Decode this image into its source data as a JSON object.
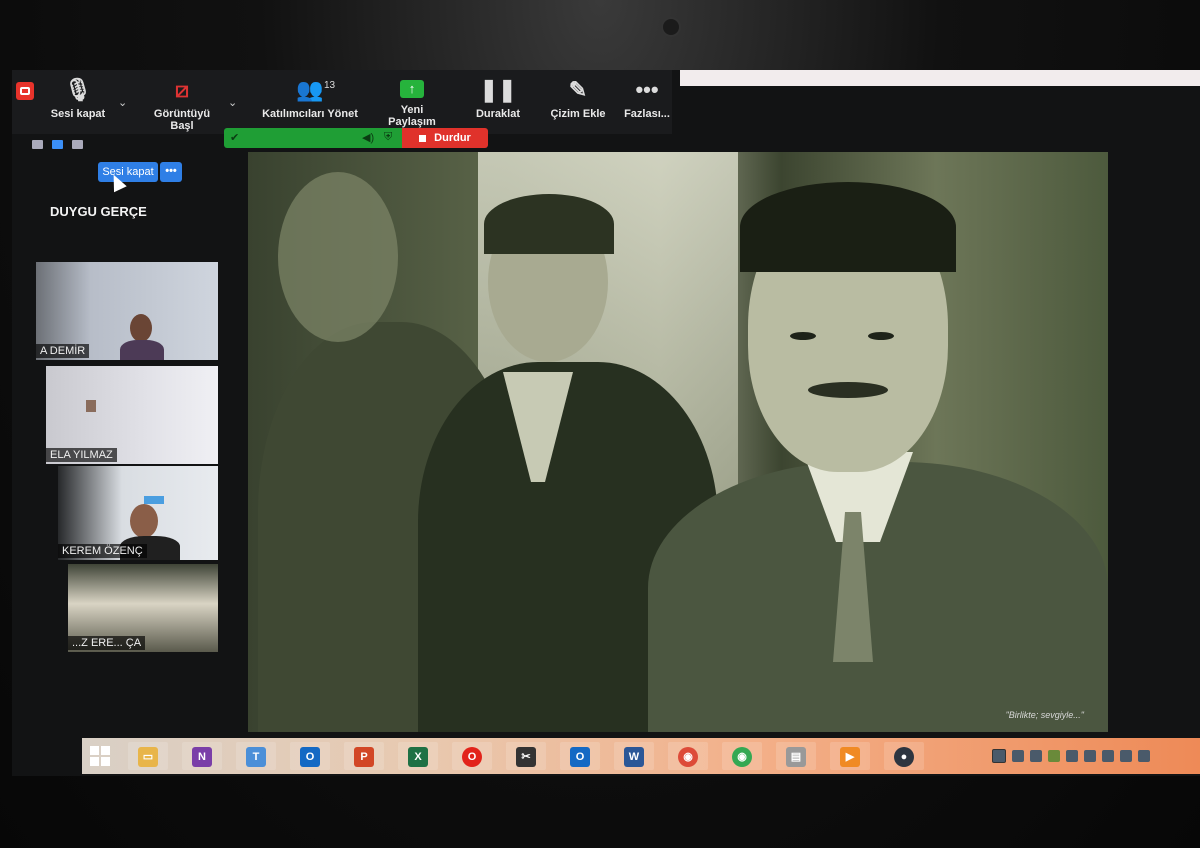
{
  "toolbar": {
    "mute": {
      "label": "Sesi kapat",
      "icon": "microphone-icon"
    },
    "video": {
      "label": "Görüntüyü Başl",
      "icon": "video-off-icon"
    },
    "participants": {
      "label": "Katılımcıları Yönet",
      "count": "13",
      "icon": "participants-icon"
    },
    "share": {
      "label": "Yeni Paylaşım",
      "icon": "share-arrow-icon"
    },
    "pause": {
      "label": "Duraklat",
      "icon": "pause-icon"
    },
    "annotate": {
      "label": "Çizim Ekle",
      "icon": "pen-icon"
    },
    "more": {
      "label": "Fazlası...",
      "icon": "more-icon"
    }
  },
  "share_status": {
    "stop_label": "Durdur",
    "accent": "#1f9e35",
    "stop_color": "#e0322b"
  },
  "panel": {
    "mute_button": "Sesi kapat",
    "more_button": "•••",
    "host_name": "DUYGU GERÇE",
    "participants": [
      {
        "name": "A DEMİR"
      },
      {
        "name": "ELA YILMAZ"
      },
      {
        "name": "KEREM ÖZENÇ"
      },
      {
        "name": "...Z ERE... ÇA"
      }
    ]
  },
  "shared_content": {
    "caption": "\"Birlikte; sevgiyle...\""
  },
  "taskbar": {
    "apps": [
      "file-explorer",
      "onenote",
      "teams",
      "outlook",
      "powerpoint",
      "excel",
      "opera",
      "snipping-tool",
      "outlook",
      "word",
      "chrome",
      "chrome",
      "paint",
      "media-player",
      "zoom"
    ]
  }
}
